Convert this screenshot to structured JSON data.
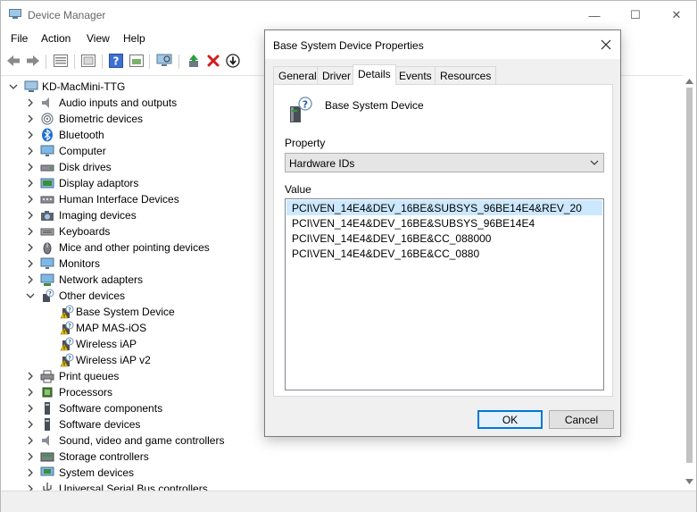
{
  "window": {
    "title": "Device Manager",
    "controls": {
      "minimize": "—",
      "maximize": "☐",
      "close": "✕"
    }
  },
  "menu": [
    "File",
    "Action",
    "View",
    "Help"
  ],
  "toolbar_icons": [
    "back-icon",
    "forward-icon",
    "properties-icon",
    "show-hide-icon",
    "help-icon",
    "update-driver-icon",
    "scan-hardware-icon",
    "enable-device-icon",
    "uninstall-icon",
    "disable-device-icon"
  ],
  "tree": {
    "root": "KD-MacMini-TTG",
    "items": [
      {
        "label": "Audio inputs and outputs",
        "icon": "speaker-icon",
        "expanded": false
      },
      {
        "label": "Biometric devices",
        "icon": "fingerprint-icon",
        "expanded": false
      },
      {
        "label": "Bluetooth",
        "icon": "bluetooth-icon",
        "expanded": false
      },
      {
        "label": "Computer",
        "icon": "monitor-icon",
        "expanded": false
      },
      {
        "label": "Disk drives",
        "icon": "disk-icon",
        "expanded": false
      },
      {
        "label": "Display adaptors",
        "icon": "display-adapter-icon",
        "expanded": false
      },
      {
        "label": "Human Interface Devices",
        "icon": "hid-icon",
        "expanded": false
      },
      {
        "label": "Imaging devices",
        "icon": "camera-icon",
        "expanded": false
      },
      {
        "label": "Keyboards",
        "icon": "keyboard-icon",
        "expanded": false
      },
      {
        "label": "Mice and other pointing devices",
        "icon": "mouse-icon",
        "expanded": false
      },
      {
        "label": "Monitors",
        "icon": "monitor-icon",
        "expanded": false
      },
      {
        "label": "Network adapters",
        "icon": "network-icon",
        "expanded": false
      },
      {
        "label": "Other devices",
        "icon": "other-devices-icon",
        "expanded": true
      },
      {
        "label": "Base System Device",
        "icon": "warning-device-icon",
        "child": true
      },
      {
        "label": "MAP MAS-iOS",
        "icon": "warning-device-icon",
        "child": true
      },
      {
        "label": "Wireless iAP",
        "icon": "warning-device-icon",
        "child": true
      },
      {
        "label": "Wireless iAP v2",
        "icon": "warning-device-icon",
        "child": true
      },
      {
        "label": "Print queues",
        "icon": "printer-icon",
        "expanded": false
      },
      {
        "label": "Processors",
        "icon": "processor-icon",
        "expanded": false
      },
      {
        "label": "Software components",
        "icon": "software-icon",
        "expanded": false
      },
      {
        "label": "Software devices",
        "icon": "software-icon",
        "expanded": false
      },
      {
        "label": "Sound, video and game controllers",
        "icon": "speaker-icon",
        "expanded": false
      },
      {
        "label": "Storage controllers",
        "icon": "storage-icon",
        "expanded": false
      },
      {
        "label": "System devices",
        "icon": "system-icon",
        "expanded": false
      },
      {
        "label": "Universal Serial Bus controllers",
        "icon": "usb-icon",
        "expanded": false
      }
    ]
  },
  "dialog": {
    "title": "Base System Device Properties",
    "tabs": [
      "General",
      "Driver",
      "Details",
      "Events",
      "Resources"
    ],
    "active_tab": "Details",
    "device_name": "Base System Device",
    "property_label": "Property",
    "property_value": "Hardware IDs",
    "value_label": "Value",
    "values": [
      "PCI\\VEN_14E4&DEV_16BE&SUBSYS_96BE14E4&REV_20",
      "PCI\\VEN_14E4&DEV_16BE&SUBSYS_96BE14E4",
      "PCI\\VEN_14E4&DEV_16BE&CC_088000",
      "PCI\\VEN_14E4&DEV_16BE&CC_0880"
    ],
    "ok_label": "OK",
    "cancel_label": "Cancel"
  },
  "colors": {
    "selection": "#cce8ff",
    "accent": "#0078d7",
    "warning": "#f2c400"
  }
}
